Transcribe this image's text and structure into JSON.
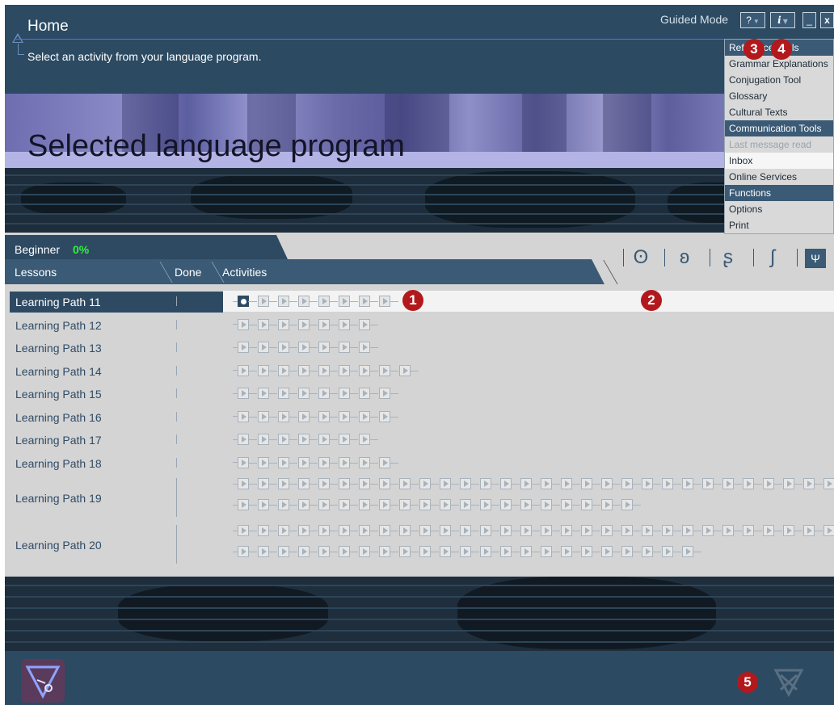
{
  "header": {
    "title": "Home",
    "subtitle": "Select an activity from your language program.",
    "mode_label": "Guided Mode",
    "help_label": "?",
    "info_label": "i",
    "minimize_label": "_",
    "close_label": "x"
  },
  "banner": {
    "title": "Selected language program"
  },
  "menu": {
    "items": [
      {
        "label": "Reference Tools",
        "kind": "header"
      },
      {
        "label": "Grammar Explanations",
        "kind": "item"
      },
      {
        "label": "Conjugation Tool",
        "kind": "item"
      },
      {
        "label": "Glossary",
        "kind": "item"
      },
      {
        "label": "Cultural Texts",
        "kind": "item"
      },
      {
        "label": "Communication Tools",
        "kind": "header"
      },
      {
        "label": "Last message read",
        "kind": "disabled"
      },
      {
        "label": "Inbox",
        "kind": "highlight"
      },
      {
        "label": "Online Services",
        "kind": "item"
      },
      {
        "label": "Functions",
        "kind": "header"
      },
      {
        "label": "Options",
        "kind": "item"
      },
      {
        "label": "Print",
        "kind": "item"
      }
    ]
  },
  "tabs": {
    "level": "Beginner",
    "progress": "0%",
    "columns": {
      "lessons": "Lessons",
      "done": "Done",
      "activities": "Activities"
    }
  },
  "toolbar": {
    "icons": [
      "listen-speak-icon",
      "speak-icon",
      "read-write-icon",
      "write-icon",
      "review-icon"
    ]
  },
  "lessons": [
    {
      "name": "Learning Path 11",
      "selected": true,
      "activity_rows": [
        8
      ]
    },
    {
      "name": "Learning Path 12",
      "selected": false,
      "activity_rows": [
        7
      ]
    },
    {
      "name": "Learning Path 13",
      "selected": false,
      "activity_rows": [
        7
      ]
    },
    {
      "name": "Learning Path 14",
      "selected": false,
      "activity_rows": [
        9
      ]
    },
    {
      "name": "Learning Path 15",
      "selected": false,
      "activity_rows": [
        8
      ]
    },
    {
      "name": "Learning Path 16",
      "selected": false,
      "activity_rows": [
        8
      ]
    },
    {
      "name": "Learning Path 17",
      "selected": false,
      "activity_rows": [
        7
      ]
    },
    {
      "name": "Learning Path 18",
      "selected": false,
      "activity_rows": [
        8
      ]
    },
    {
      "name": "Learning Path 19",
      "selected": false,
      "activity_rows": [
        30,
        20
      ]
    },
    {
      "name": "Learning Path 20",
      "selected": false,
      "activity_rows": [
        30,
        23
      ]
    }
  ],
  "markers": [
    "1",
    "2",
    "3",
    "4",
    "5"
  ],
  "colors": {
    "accent": "#2e4a63",
    "progress": "#2ef23a",
    "marker": "#b3191c",
    "banner_band": "#b3b3e6"
  }
}
